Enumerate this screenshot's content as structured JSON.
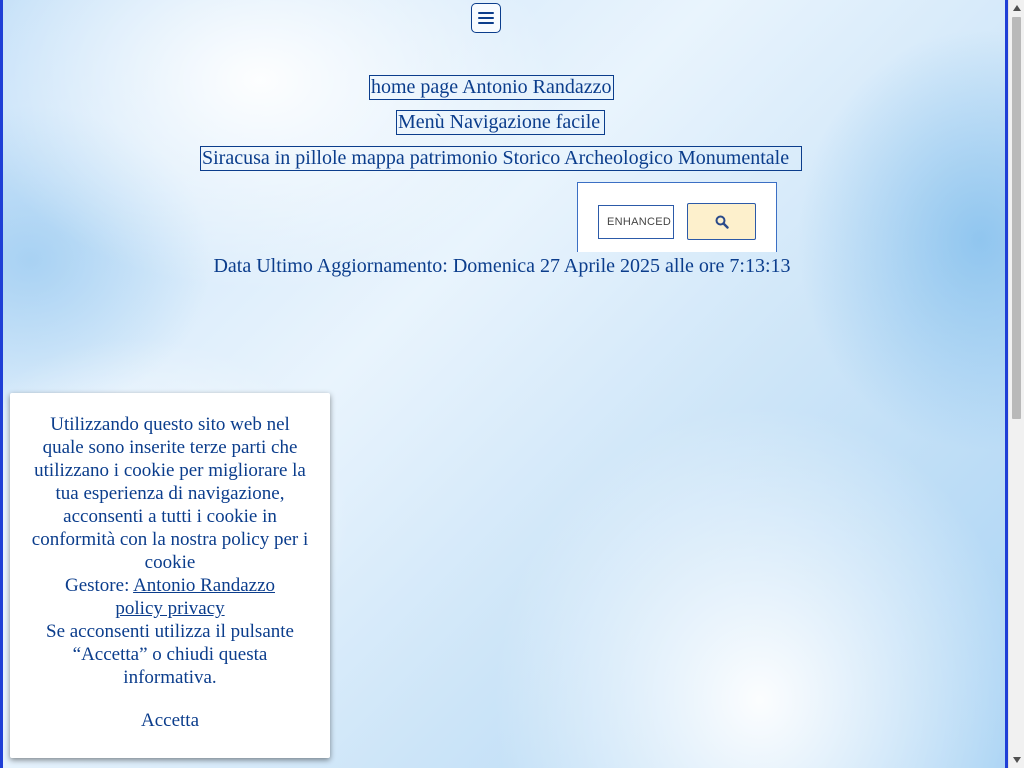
{
  "menu": {
    "icon": "hamburger-menu-icon"
  },
  "nav": {
    "home_link": "home page Antonio Randazzo",
    "easy_nav_link": "Menù Navigazione facile",
    "siracusa_link": "Siracusa in pillole mappa patrimonio Storico Archeologico Monumentale"
  },
  "search": {
    "placeholder": "ENHANCED BY Google",
    "visible_text": "ENHANCED",
    "button_icon": "search-icon"
  },
  "update": {
    "text": "Data Ultimo Aggiornamento: Domenica 27 Aprile 2025 alle ore 7:13:13"
  },
  "cookie": {
    "line1": "Utilizzando questo sito web nel quale sono inserite terze parti che utilizzano i cookie per migliorare la tua esperienza di navigazione, acconsenti a tutti i cookie in conformità con la nostra policy per i cookie",
    "manager_label": "Gestore: ",
    "manager_link": "Antonio Randazzo",
    "policy_link": "policy privacy",
    "line3": "Se acconsenti utilizza il pulsante “Accetta” o chiudi questa informativa.",
    "accept_label": "Accetta"
  },
  "colors": {
    "text": "#0b3d8c",
    "edge": "#1f3fd6",
    "search_button_bg": "#fdf0cc"
  }
}
